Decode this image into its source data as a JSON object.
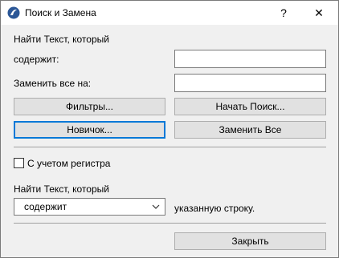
{
  "window": {
    "title": "Поиск и Замена",
    "help_glyph": "?",
    "close_glyph": "✕",
    "accent": "#0078d7"
  },
  "form": {
    "find_label": "Найти Текст, который",
    "contains_label": "содержит:",
    "contains_value": "",
    "replace_label": "Заменить все на:",
    "replace_value": ""
  },
  "buttons": {
    "filters": "Фильтры...",
    "start_search": "Начать Поиск...",
    "new": "Новичок...",
    "replace_all": "Заменить Все",
    "close": "Закрыть"
  },
  "options": {
    "case_label": "С учетом регистра",
    "case_checked": false,
    "find_label2": "Найти Текст, который",
    "match_mode_selected": "содержит",
    "suffix": "указанную строку."
  }
}
